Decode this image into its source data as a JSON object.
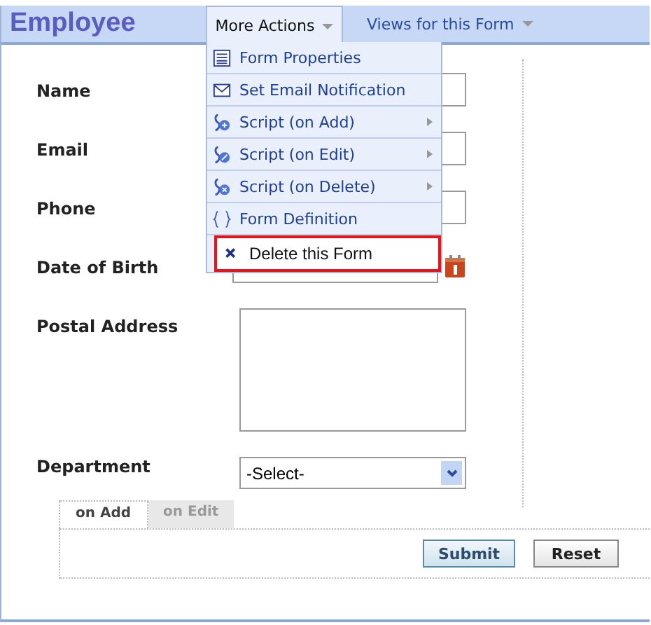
{
  "header": {
    "title": "Employee",
    "more_actions": "More Actions",
    "views": "Views for this Form"
  },
  "menu": [
    {
      "kind": "list",
      "label": "Form Properties",
      "submenu": false,
      "selected": false
    },
    {
      "kind": "mail",
      "label": "Set Email Notification",
      "submenu": false,
      "selected": false
    },
    {
      "kind": "script-add",
      "label": "Script (on Add)",
      "submenu": true,
      "selected": false
    },
    {
      "kind": "script-edit",
      "label": "Script (on Edit)",
      "submenu": true,
      "selected": false
    },
    {
      "kind": "script-delete",
      "label": "Script (on Delete)",
      "submenu": true,
      "selected": false
    },
    {
      "kind": "braces",
      "label": "Form Definition",
      "submenu": false,
      "selected": false
    },
    {
      "kind": "delete",
      "label": "Delete this Form",
      "submenu": false,
      "selected": true
    }
  ],
  "fields": [
    {
      "kind": "text",
      "label": "Name"
    },
    {
      "kind": "text",
      "label": "Email"
    },
    {
      "kind": "text",
      "label": "Phone"
    },
    {
      "kind": "date",
      "label": "Date of Birth"
    },
    {
      "kind": "textarea",
      "label": "Postal Address"
    },
    {
      "kind": "select",
      "label": "Department",
      "value": "-Select-"
    }
  ],
  "tabs": [
    {
      "label": "on Add",
      "selected": true
    },
    {
      "label": "on Edit",
      "selected": false
    }
  ],
  "buttons": [
    {
      "kind": "primary",
      "label": "Submit"
    },
    {
      "kind": "secondary",
      "label": "Reset"
    }
  ]
}
